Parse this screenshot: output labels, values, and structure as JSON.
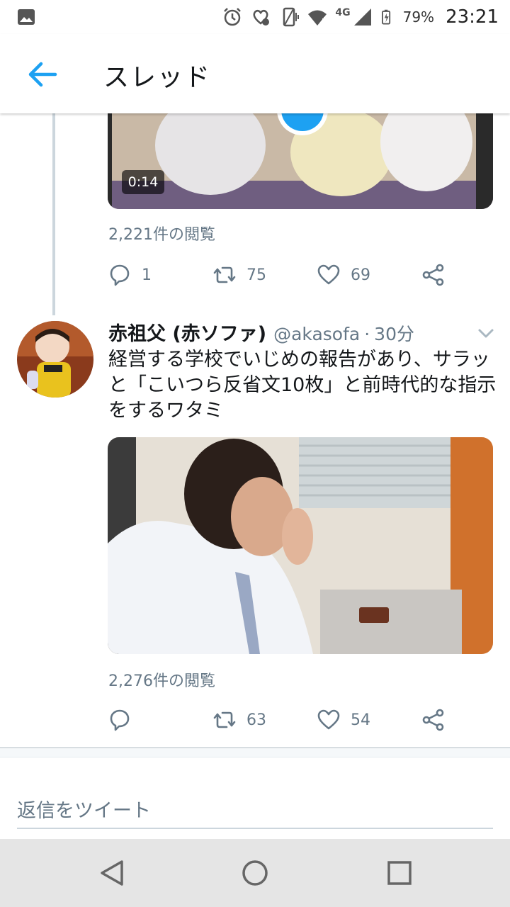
{
  "status_bar": {
    "network": "4G",
    "battery_percent": "79%",
    "time": "23:21",
    "icons": [
      "gallery-icon",
      "alarm-icon",
      "health-icon",
      "vibrate-icon",
      "wifi-icon",
      "signal-icon",
      "battery-icon"
    ]
  },
  "header": {
    "title": "スレッド",
    "back_icon": "back-arrow-icon"
  },
  "colors": {
    "accent": "#1da1f2",
    "secondary_text": "#657786",
    "divider": "#e6ecf0"
  },
  "tweets": [
    {
      "media": {
        "type": "video",
        "duration": "0:14"
      },
      "views": "2,221件の閲覧",
      "actions": {
        "reply": "1",
        "retweet": "75",
        "like": "69"
      }
    },
    {
      "display_name": "赤祖父 (赤ソファ)",
      "handle": "@akasofa",
      "separator": "·",
      "time": "30分",
      "text": "経営する学校でいじめの報告があり、サラッと「こいつら反省文10枚」と前時代的な指示をするワタミ",
      "media": {
        "type": "video"
      },
      "views": "2,276件の閲覧",
      "actions": {
        "reply": "",
        "retweet": "63",
        "like": "54"
      }
    }
  ],
  "reply_bar": {
    "placeholder": "返信をツイート"
  },
  "nav_bar": {
    "buttons": [
      "back-triangle-icon",
      "home-circle-icon",
      "recents-square-icon"
    ]
  }
}
